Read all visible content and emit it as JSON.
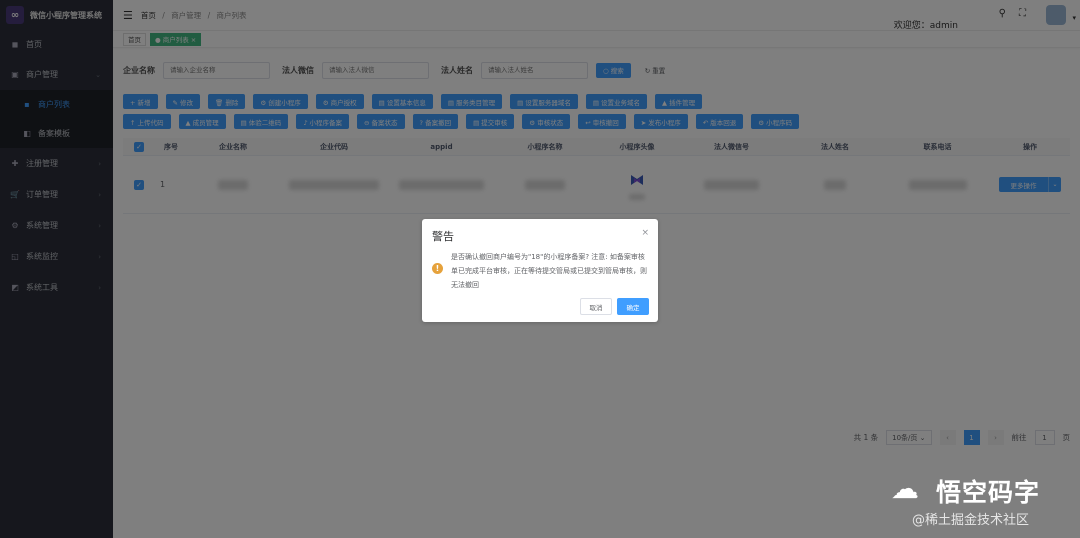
{
  "app": {
    "title": "微信小程序管理系统",
    "logo_glyph": "∞"
  },
  "sidebar": {
    "items": [
      {
        "icon": "home-icon",
        "glyph": "◼",
        "label": "首页"
      },
      {
        "icon": "merchant-icon",
        "glyph": "▣",
        "label": "商户管理",
        "arrow": "⌄"
      },
      {
        "icon": "list-icon",
        "glyph": "▪",
        "label": "商户列表"
      },
      {
        "icon": "template-icon",
        "glyph": "◧",
        "label": "备案模板"
      },
      {
        "icon": "register-icon",
        "glyph": "✚",
        "label": "注册管理",
        "arrow": "›"
      },
      {
        "icon": "cart-icon",
        "glyph": "🛒",
        "label": "订单管理",
        "arrow": "›"
      },
      {
        "icon": "gear-icon",
        "glyph": "⚙",
        "label": "系统管理",
        "arrow": "›"
      },
      {
        "icon": "monitor-icon",
        "glyph": "◱",
        "label": "系统监控",
        "arrow": "›"
      },
      {
        "icon": "tool-icon",
        "glyph": "◩",
        "label": "系统工具",
        "arrow": "›"
      }
    ]
  },
  "navbar": {
    "hamburger": "☰",
    "breadcrumb": [
      "首页",
      "商户管理",
      "商户列表"
    ],
    "breadcrumb_sep": "/",
    "welcome": "欢迎您：admin",
    "search_glyph": "⚲",
    "fullscreen_glyph": "⛶",
    "caret": "▾"
  },
  "tags": [
    "首页",
    "● 商户列表 ×"
  ],
  "search": {
    "fields": [
      {
        "label": "企业名称",
        "placeholder": "请输入企业名称"
      },
      {
        "label": "法人微信",
        "placeholder": "请输入法人微信"
      },
      {
        "label": "法人姓名",
        "placeholder": "请输入法人姓名"
      }
    ],
    "search_btn": "○ 搜索",
    "reset_btn": "↻ 重置"
  },
  "toolbar_row1": [
    "+ 新增",
    "✎ 修改",
    "🗑 删除",
    "⚙ 创建小程序",
    "⚙ 商户授权",
    "▤ 设置基本信息",
    "▤ 服务类目管理",
    "▤ 设置服务器域名",
    "▤ 设置业务域名",
    "▲ 插件管理"
  ],
  "toolbar_row2": [
    "↑ 上传代码",
    "▲ 成员管理",
    "▤ 体验二维码",
    "♪ 小程序备案",
    "⊖ 备案状态",
    "? 备案撤回",
    "▤ 提交审核",
    "⚙ 审核状态",
    "↩ 审核撤回",
    "➤ 发布小程序",
    "↶ 版本回退",
    "⚙ 小程序码"
  ],
  "table": {
    "columns": [
      "序号",
      "企业名称",
      "企业代码",
      "appid",
      "小程序名称",
      "小程序头像",
      "法人微信号",
      "法人姓名",
      "联系电话",
      "操作"
    ],
    "check_glyph": "✓",
    "rows": [
      {
        "index": "1",
        "action": "更多操作",
        "dropdown": "⌄"
      }
    ]
  },
  "pagination": {
    "total": "共 1 条",
    "page_size": "10条/页 ⌄",
    "prev": "‹",
    "current": "1",
    "next": "›",
    "goto_label": "前往",
    "goto_value": "1",
    "page_suffix": "页"
  },
  "dialog": {
    "title": "警告",
    "close": "×",
    "warn_glyph": "!",
    "message": "是否确认撤回商户编号为\"18\"的小程序备案? 注意: 如备案审核单已完成平台审核，正在等待提交管局或已提交到管局审核，则无法撤回",
    "cancel": "取消",
    "confirm": "确定"
  },
  "watermark": {
    "logo_glyph": "☁",
    "title": "悟空码字",
    "sub": "@稀土掘金技术社区"
  },
  "colors": {
    "primary": "#409eff",
    "sidebar": "#2c2f3a",
    "warning": "#e6a23c",
    "tag_active": "#42b983"
  }
}
